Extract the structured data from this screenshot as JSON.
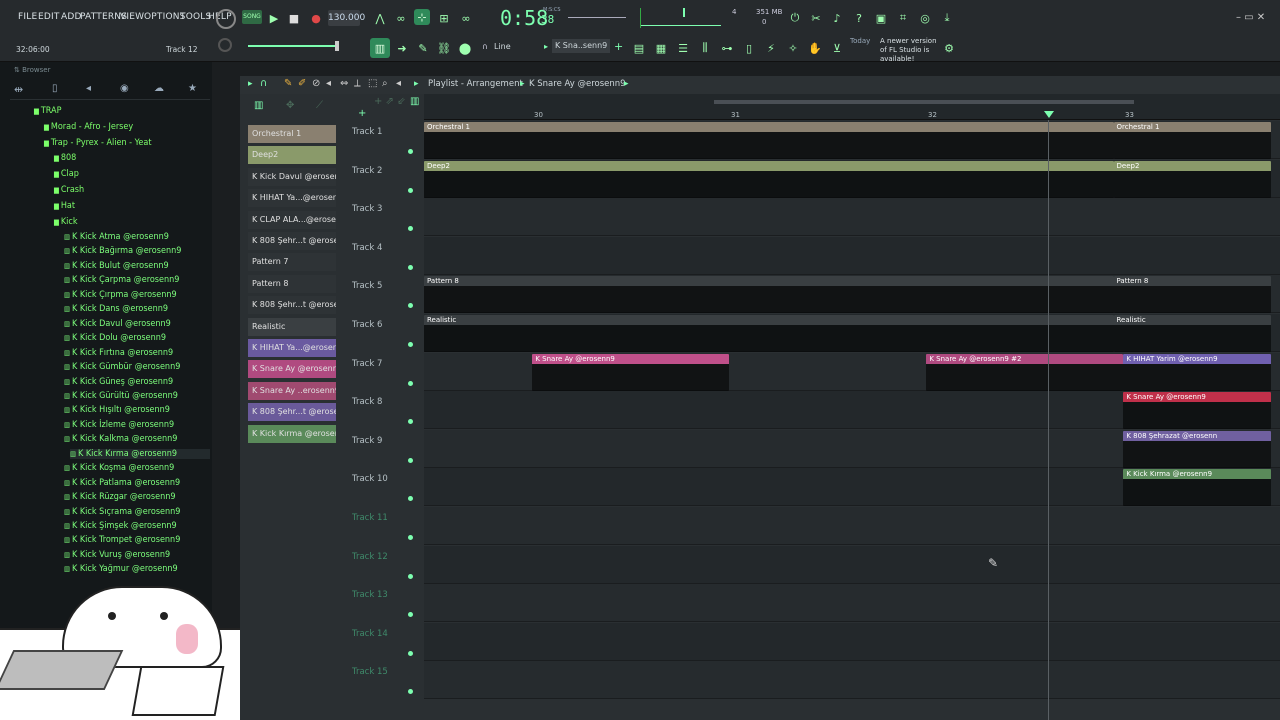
{
  "menu": [
    "FILE",
    "EDIT",
    "ADD",
    "PATTERNS",
    "VIEW",
    "OPTIONS",
    "TOOLS",
    "HELP"
  ],
  "transport": {
    "bpm": "130.000",
    "time": "0:58",
    "time_small": "38",
    "time_unit": "M:S:CS",
    "cpu": "4",
    "mem": "351 MB",
    "poly": "0"
  },
  "hint": {
    "time": "32:06:00",
    "track": "Track 12"
  },
  "toolbar": {
    "snap": "Line",
    "pattern": "K Sna..senn9",
    "news_today": "Today",
    "news_text": "A newer version of FL Studio is available!"
  },
  "browser": {
    "title": "Browser",
    "folders": [
      "TRAP",
      "Morad - Afro - Jersey",
      "Trap - Pyrex - Alien - Yeat",
      "808",
      "Clap",
      "Crash",
      "Hat",
      "Kick"
    ],
    "files": [
      "K Kick Atma @erosenn9",
      "K Kick Bağırma @erosenn9",
      "K Kick Bulut @erosenn9",
      "K Kick Çarpma @erosenn9",
      "K Kick Çırpma @erosenn9",
      "K Kick Dans @erosenn9",
      "K Kick Davul @erosenn9",
      "K Kick Dolu @erosenn9",
      "K Kick Fırtına @erosenn9",
      "K Kick Gümbür @erosenn9",
      "K Kick Güneş @erosenn9",
      "K Kick Gürültü @erosenn9",
      "K Kick Hışıltı @erosenn9",
      "K Kick İzleme @erosenn9",
      "K Kick Kalkma @erosenn9",
      "K Kick Kırma @erosenn9",
      "K Kick Koşma @erosenn9",
      "K Kick Patlama @erosenn9",
      "K Kick Rüzgar @erosenn9",
      "K Kick Sıçrama @erosenn9",
      "K Kick Şimşek @erosenn9",
      "K Kick Trompet @erosenn9",
      "K Kick Vuruş @erosenn9",
      "K Kick Yağmur @erosenn9"
    ],
    "selected_index": 15
  },
  "playlist": {
    "title": "Playlist - Arrangement",
    "pattern_crumb": "K Snare Ay @erosenn9",
    "bar_numbers": [
      "30",
      "31",
      "32",
      "33"
    ],
    "patterns": [
      {
        "name": "Orchestral 1",
        "color": "#8a8070"
      },
      {
        "name": "Deep2",
        "color": "#8a9a6a"
      },
      {
        "name": "K Kick Davul @erosenn9",
        "color": "#2e3336"
      },
      {
        "name": "K HIHAT Ya...@erosenn9",
        "color": "#2e3336"
      },
      {
        "name": "K CLAP ALA...@erosenn9",
        "color": "#2e3336"
      },
      {
        "name": "K 808 Şehr...t @erosenn",
        "color": "#2e3336"
      },
      {
        "name": "Pattern 7",
        "color": "#2e3336"
      },
      {
        "name": "Pattern 8",
        "color": "#2e3336"
      },
      {
        "name": "K 808 Şehr...t @erosenn",
        "color": "#2e3336"
      },
      {
        "name": "Realistic",
        "color": "#3a3f42"
      },
      {
        "name": "K HIHAT Ya...@erosenn9",
        "color": "#6a5aa0"
      },
      {
        "name": "K Snare Ay @erosenn9",
        "color": "#b04a80"
      },
      {
        "name": "K Snare Ay ..erosenn9 #2",
        "color": "#a04a70"
      },
      {
        "name": "K 808 Şehr...t @erosenn",
        "color": "#6a5a9a"
      },
      {
        "name": "K Kick Kırma @erosenn9",
        "color": "#5a8a5a"
      }
    ],
    "tracks": [
      "Track 1",
      "Track 2",
      "Track 3",
      "Track 4",
      "Track 5",
      "Track 6",
      "Track 7",
      "Track 8",
      "Track 9",
      "Track 10",
      "Track 11",
      "Track 12",
      "Track 13",
      "Track 14",
      "Track 15"
    ],
    "clips": [
      {
        "track": 0,
        "label": "Orchestral 1",
        "start": 0,
        "end": 3.5,
        "color": "#8a8070"
      },
      {
        "track": 0,
        "label": "Orchestral 1",
        "start": 3.5,
        "end": 4.3,
        "color": "#8a8070"
      },
      {
        "track": 1,
        "label": "Deep2",
        "start": 0,
        "end": 3.5,
        "color": "#8a9a6a"
      },
      {
        "track": 1,
        "label": "Deep2",
        "start": 3.5,
        "end": 4.3,
        "color": "#8a9a6a"
      },
      {
        "track": 4,
        "label": "Pattern 8",
        "start": 0,
        "end": 3.5,
        "color": "#3a3f42"
      },
      {
        "track": 4,
        "label": "Pattern 8",
        "start": 3.5,
        "end": 4.3,
        "color": "#3a3f42"
      },
      {
        "track": 5,
        "label": "Realistic",
        "start": 0,
        "end": 3.5,
        "color": "#3a3f42"
      },
      {
        "track": 5,
        "label": "Realistic",
        "start": 3.5,
        "end": 4.3,
        "color": "#3a3f42"
      },
      {
        "track": 6,
        "label": "K Snare Ay @erosenn9",
        "start": 0.55,
        "end": 1.55,
        "color": "#c0508a"
      },
      {
        "track": 6,
        "label": "K Snare Ay @erosenn9 #2",
        "start": 2.55,
        "end": 3.55,
        "color": "#b04a80"
      },
      {
        "track": 6,
        "label": "K HIHAT Yarim @erosenn9",
        "start": 3.55,
        "end": 4.3,
        "color": "#7060b0"
      },
      {
        "track": 7,
        "label": "K Snare Ay @erosenn9",
        "start": 3.55,
        "end": 4.3,
        "color": "#c0304a"
      },
      {
        "track": 8,
        "label": "K 808 Şehrazat @erosenn",
        "start": 3.55,
        "end": 4.3,
        "color": "#7060a0"
      },
      {
        "track": 9,
        "label": "K Kick Kırma @erosenn9",
        "start": 3.55,
        "end": 4.3,
        "color": "#5a8a5a"
      }
    ]
  }
}
